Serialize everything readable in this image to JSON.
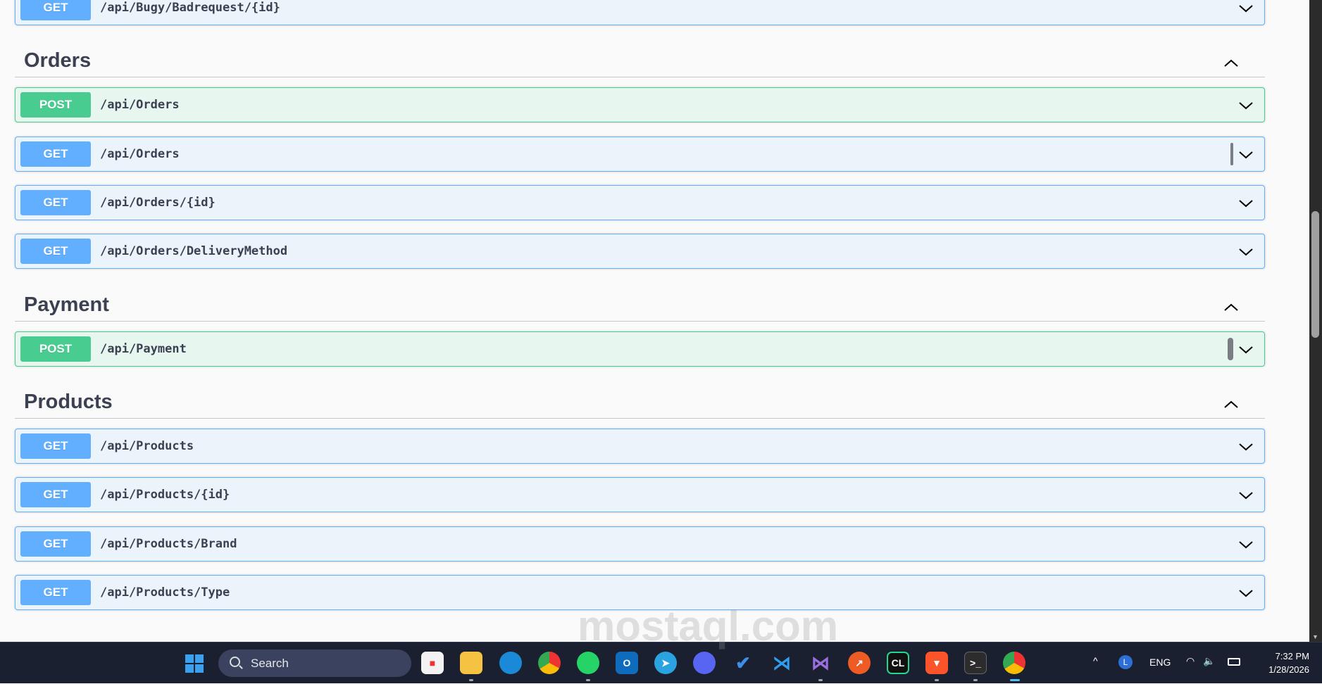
{
  "sections": [
    {
      "name": "",
      "ops": [
        {
          "method": "GET",
          "path": "/api/Bugy/Badrequest/{id}"
        }
      ]
    },
    {
      "name": "Orders",
      "ops": [
        {
          "method": "POST",
          "path": "/api/Orders"
        },
        {
          "method": "GET",
          "path": "/api/Orders"
        },
        {
          "method": "GET",
          "path": "/api/Orders/{id}"
        },
        {
          "method": "GET",
          "path": "/api/Orders/DeliveryMethod"
        }
      ]
    },
    {
      "name": "Payment",
      "ops": [
        {
          "method": "POST",
          "path": "/api/Payment"
        }
      ]
    },
    {
      "name": "Products",
      "ops": [
        {
          "method": "GET",
          "path": "/api/Products"
        },
        {
          "method": "GET",
          "path": "/api/Products/{id}"
        },
        {
          "method": "GET",
          "path": "/api/Products/Brand"
        },
        {
          "method": "GET",
          "path": "/api/Products/Type"
        }
      ]
    }
  ],
  "colors": {
    "get": "#61affe",
    "post": "#49cc90",
    "get_bg": "#ebf3fb",
    "post_bg": "#e8f6f0"
  },
  "taskbar": {
    "search_placeholder": "Search",
    "apps": [
      "microsoft-store",
      "file-explorer",
      "edge",
      "chrome",
      "whatsapp",
      "outlook",
      "telegram",
      "discord",
      "todo",
      "vscode",
      "visual-studio",
      "postman",
      "clion",
      "brave",
      "terminal",
      "chrome-active"
    ],
    "tray": {
      "language": "ENG",
      "time": "7:32 PM",
      "date": "1/28/2026"
    }
  },
  "watermark": "mostaql.com"
}
